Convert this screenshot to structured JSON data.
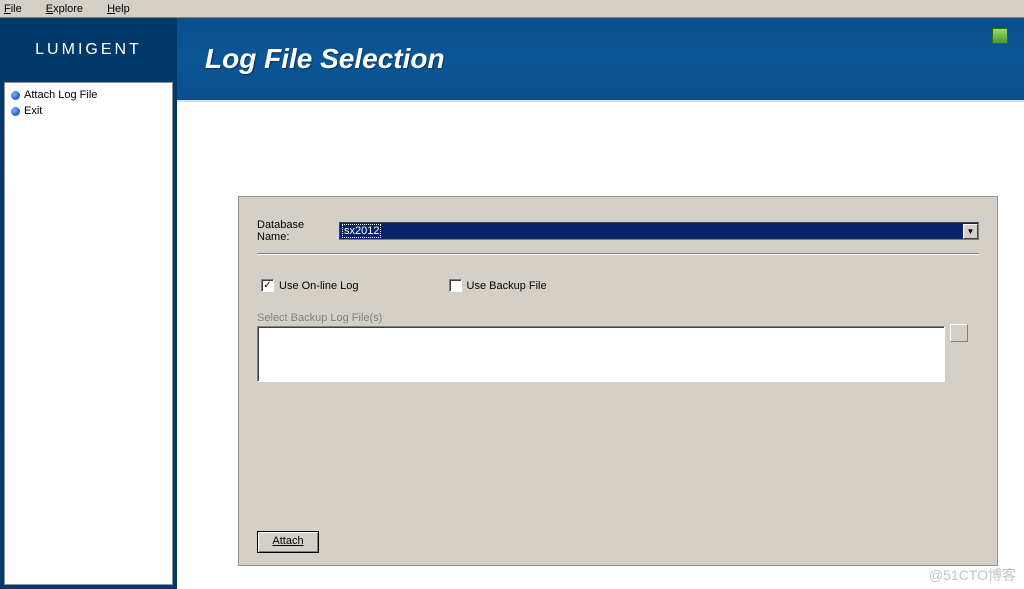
{
  "menu": {
    "file": "File",
    "explore": "Explore",
    "help": "Help"
  },
  "brand": "LUMIGENT",
  "nav": [
    {
      "label": "Attach Log File"
    },
    {
      "label": "Exit"
    }
  ],
  "page_title": "Log File Selection",
  "form": {
    "database_label": "Database Name:",
    "database_value": "sx2012",
    "use_online_log": {
      "label": "Use On-line Log",
      "checked": true
    },
    "use_backup_file": {
      "label": "Use Backup File",
      "checked": false
    },
    "backup_label": "Select Backup Log File(s)",
    "attach_label": "Attach"
  },
  "watermark": "@51CTO博客"
}
